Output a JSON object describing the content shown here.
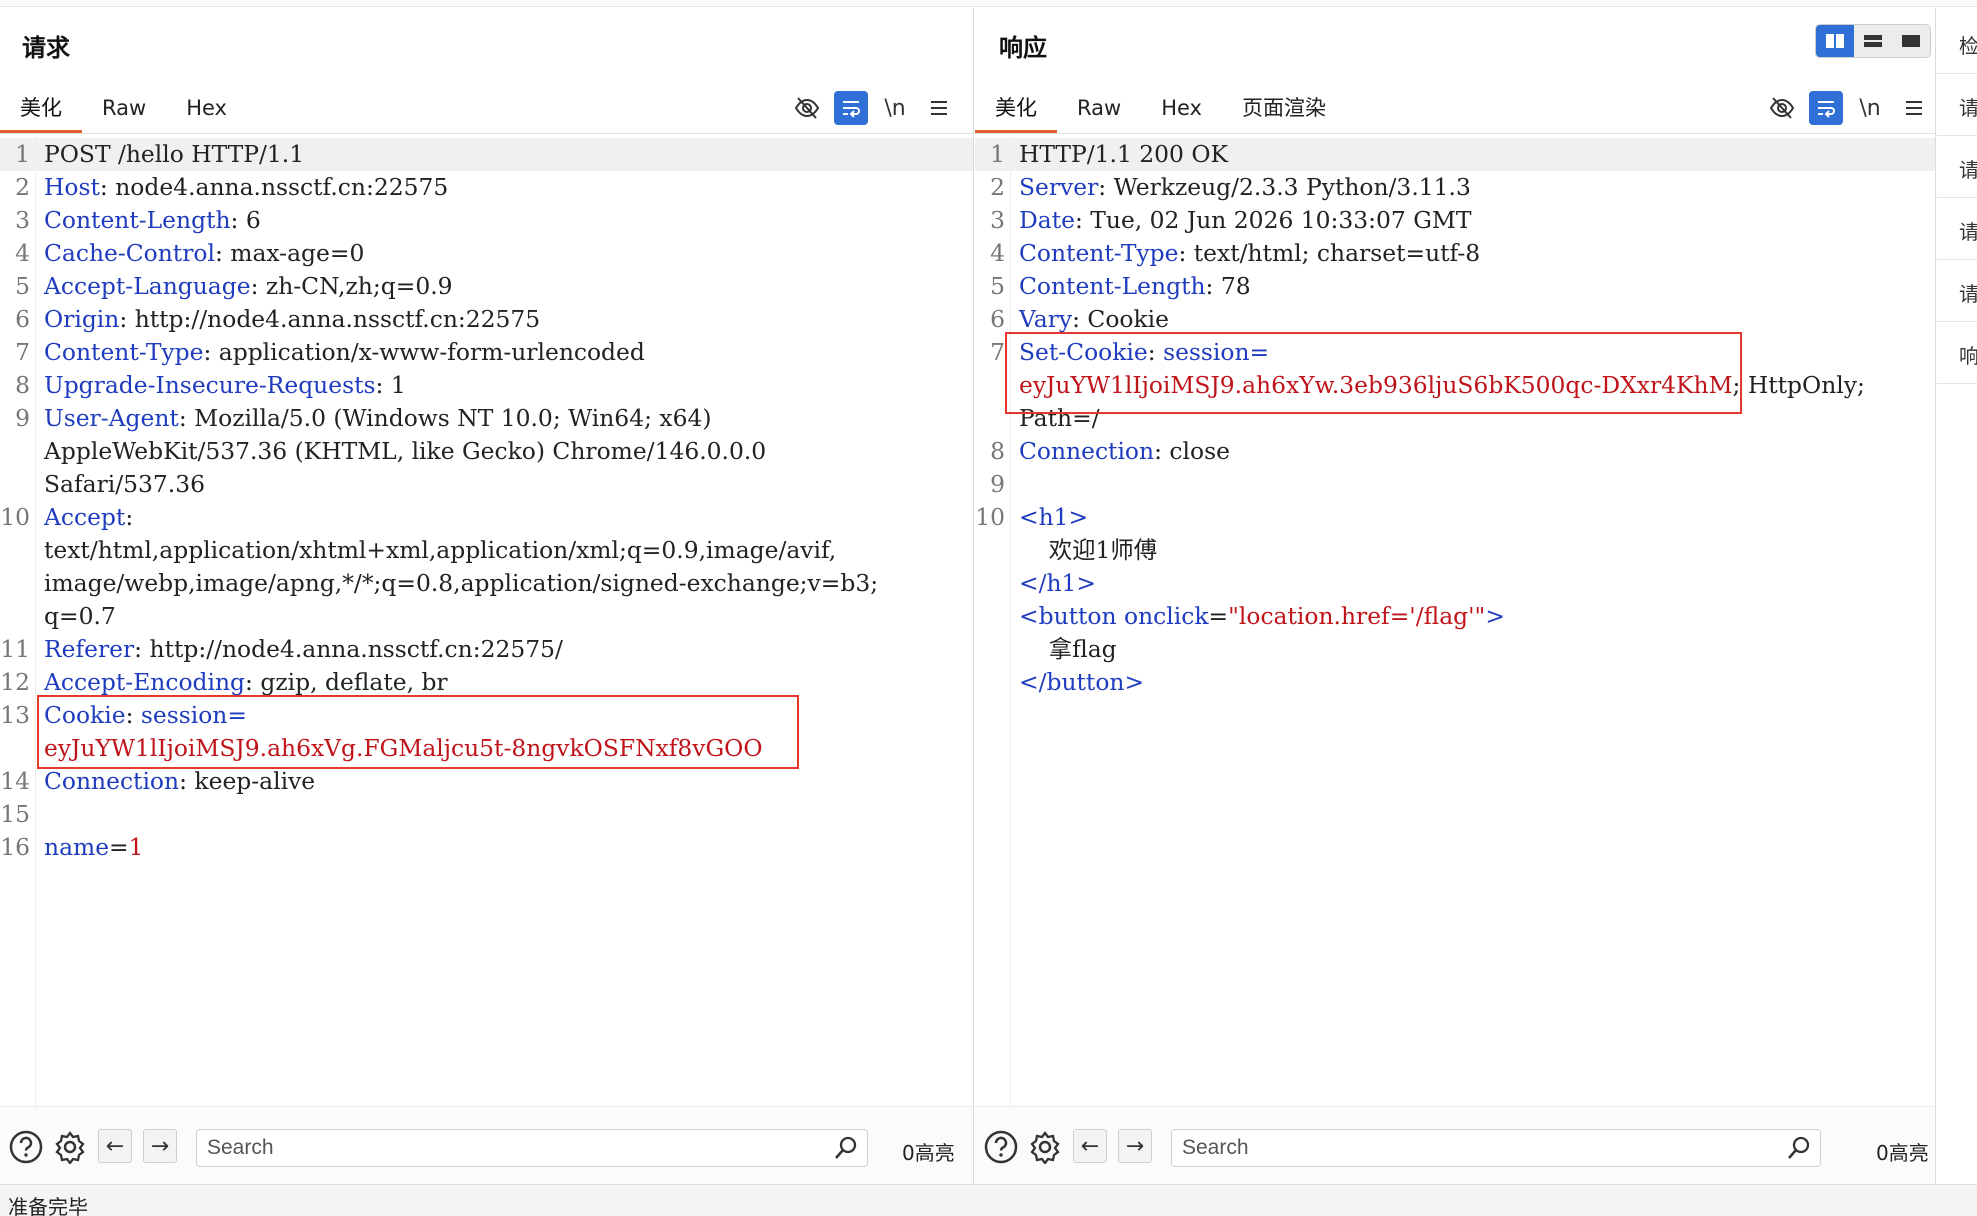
{
  "request": {
    "title": "请求",
    "tabs": [
      "美化",
      "Raw",
      "Hex"
    ],
    "active_tab": "美化",
    "tool_icons": [
      "hide-icon",
      "wrap-icon",
      "newline-toggle",
      "menu-icon"
    ],
    "newline_label": "\\n",
    "lines": [
      {
        "n": "1",
        "key": "",
        "sep": "",
        "val": "POST /hello HTTP/1.1"
      },
      {
        "n": "2",
        "key": "Host",
        "sep": ": ",
        "val": "node4.anna.nssctf.cn:22575"
      },
      {
        "n": "3",
        "key": "Content-Length",
        "sep": ": ",
        "val": "6"
      },
      {
        "n": "4",
        "key": "Cache-Control",
        "sep": ": ",
        "val": "max-age=0"
      },
      {
        "n": "5",
        "key": "Accept-Language",
        "sep": ": ",
        "val": "zh-CN,zh;q=0.9"
      },
      {
        "n": "6",
        "key": "Origin",
        "sep": ": ",
        "val": "http://node4.anna.nssctf.cn:22575"
      },
      {
        "n": "7",
        "key": "Content-Type",
        "sep": ": ",
        "val": "application/x-www-form-urlencoded"
      },
      {
        "n": "8",
        "key": "Upgrade-Insecure-Requests",
        "sep": ": ",
        "val": "1"
      },
      {
        "n": "9",
        "key": "User-Agent",
        "sep": ": ",
        "val": "Mozilla/5.0 (Windows NT 10.0; Win64; x64)"
      },
      {
        "n": "",
        "key": "",
        "sep": "",
        "val": "AppleWebKit/537.36 (KHTML, like Gecko) Chrome/146.0.0.0"
      },
      {
        "n": "",
        "key": "",
        "sep": "",
        "val": "Safari/537.36"
      },
      {
        "n": "10",
        "key": "Accept",
        "sep": ":",
        "val": ""
      },
      {
        "n": "",
        "key": "",
        "sep": "",
        "val": "text/html,application/xhtml+xml,application/xml;q=0.9,image/avif,"
      },
      {
        "n": "",
        "key": "",
        "sep": "",
        "val": "image/webp,image/apng,*/*;q=0.8,application/signed-exchange;v=b3;"
      },
      {
        "n": "",
        "key": "",
        "sep": "",
        "val": "q=0.7"
      },
      {
        "n": "11",
        "key": "Referer",
        "sep": ": ",
        "val": "http://node4.anna.nssctf.cn:22575/"
      },
      {
        "n": "12",
        "key": "Accept-Encoding",
        "sep": ": ",
        "val": "gzip, deflate, br"
      },
      {
        "n": "13",
        "key": "Cookie",
        "sep": ": ",
        "val": "",
        "extra": "session="
      },
      {
        "n": "",
        "key": "",
        "sep": "",
        "val": "",
        "red": "eyJuYW1lIjoiMSJ9.ah6xVg.FGMaljcu5t-8ngvkOSFNxf8vGOO"
      },
      {
        "n": "14",
        "key": "Connection",
        "sep": ": ",
        "val": "keep-alive"
      },
      {
        "n": "15",
        "key": "",
        "sep": "",
        "val": ""
      },
      {
        "n": "16",
        "key": "name",
        "sep": "=",
        "val": "",
        "red": "1"
      }
    ],
    "search": {
      "placeholder": "Search",
      "count": "0高亮"
    }
  },
  "response": {
    "title": "响应",
    "tabs": [
      "美化",
      "Raw",
      "Hex",
      "页面渲染"
    ],
    "active_tab": "美化",
    "tool_icons": [
      "hide-icon",
      "wrap-icon",
      "newline-toggle",
      "menu-icon"
    ],
    "newline_label": "\\n",
    "layout_buttons": [
      "split-vertical-icon",
      "split-horizontal-icon",
      "single-pane-icon"
    ],
    "lines": [
      {
        "n": "1",
        "key": "",
        "sep": "",
        "val": "HTTP/1.1 200 OK"
      },
      {
        "n": "2",
        "key": "Server",
        "sep": ": ",
        "val": "Werkzeug/2.3.3 Python/3.11.3"
      },
      {
        "n": "3",
        "key": "Date",
        "sep": ": ",
        "val": "Tue, 02 Jun 2026 10:33:07 GMT"
      },
      {
        "n": "4",
        "key": "Content-Type",
        "sep": ": ",
        "val": "text/html; charset=utf-8"
      },
      {
        "n": "5",
        "key": "Content-Length",
        "sep": ": ",
        "val": "78"
      },
      {
        "n": "6",
        "key": "Vary",
        "sep": ": ",
        "val": "Cookie"
      },
      {
        "n": "7",
        "key": "Set-Cookie",
        "sep": ": ",
        "val": "",
        "extra": "session="
      },
      {
        "n": "",
        "key": "",
        "sep": "",
        "val": "",
        "red": "eyJuYW1lIjoiMSJ9.ah6xYw.3eb936ljuS6bK500qc-DXxr4KhM",
        "after": "; HttpOnly;"
      },
      {
        "n": "",
        "key": "",
        "sep": "",
        "val": "Path=/"
      },
      {
        "n": "8",
        "key": "Connection",
        "sep": ": ",
        "val": "close"
      },
      {
        "n": "9",
        "key": "",
        "sep": "",
        "val": ""
      },
      {
        "n": "10",
        "key": "",
        "sep": "",
        "val": "",
        "tag": "<h1>"
      },
      {
        "n": "",
        "key": "",
        "sep": "",
        "val": "    欢迎1师傅"
      },
      {
        "n": "",
        "key": "",
        "sep": "",
        "val": "",
        "tag": "</h1>"
      },
      {
        "n": "",
        "key": "",
        "sep": "",
        "val": "",
        "html_button": true
      },
      {
        "n": "",
        "key": "",
        "sep": "",
        "val": "    拿flag"
      },
      {
        "n": "",
        "key": "",
        "sep": "",
        "val": "",
        "tag": "</button>"
      }
    ],
    "html_button": {
      "open": "<button ",
      "attr": "onclick",
      "eq": "=",
      "value": "\"location.href='/flag'\"",
      "close": ">"
    },
    "search": {
      "placeholder": "Search",
      "count": "0高亮"
    }
  },
  "side_panel": {
    "items": [
      "检",
      "请",
      "请",
      "请",
      "请",
      "响"
    ]
  },
  "status_text": "准备完毕"
}
